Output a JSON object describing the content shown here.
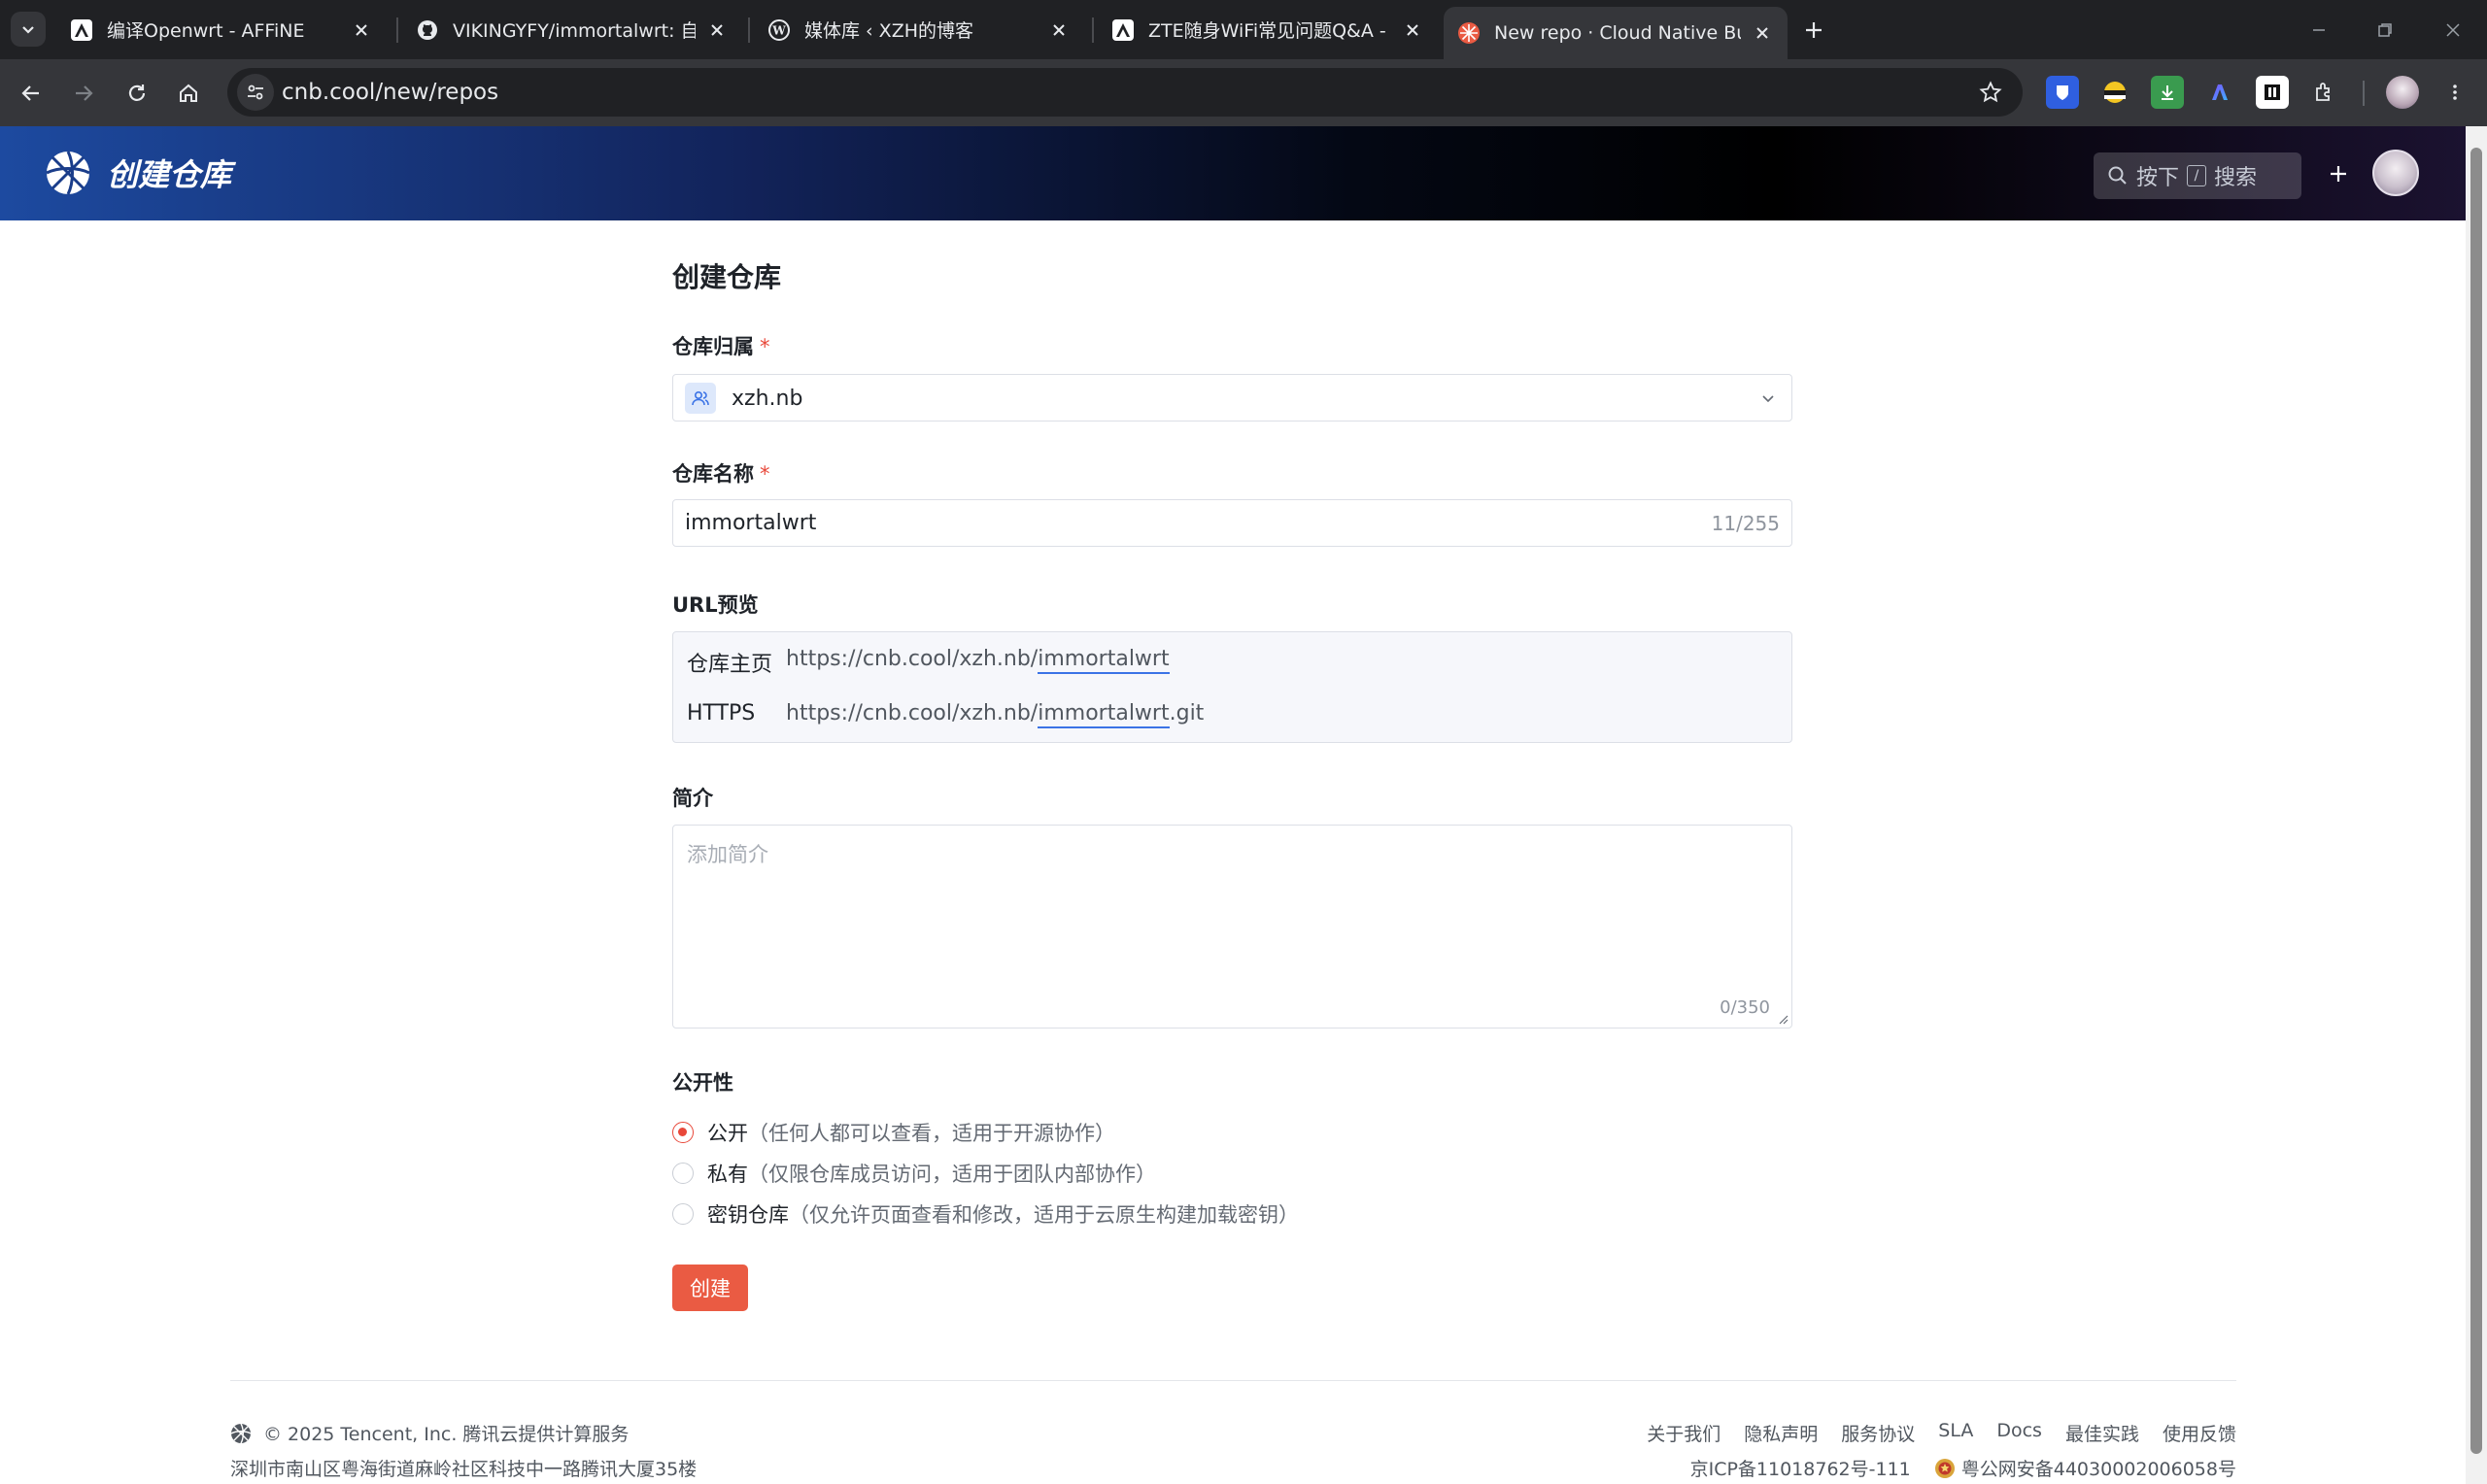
{
  "browser": {
    "tabs": [
      {
        "title": "编译Openwrt - AFFiNE",
        "active": false
      },
      {
        "title": "VIKINGYFY/immortalwrt: 自用",
        "active": false
      },
      {
        "title": "媒体库 ‹ XZH的博客",
        "active": false
      },
      {
        "title": "ZTE随身WiFi常见问题Q&A - A",
        "active": false
      },
      {
        "title": "New repo · Cloud Native Buil",
        "active": true
      }
    ],
    "url": "cnb.cool/new/repos"
  },
  "header": {
    "brand_title": "创建仓库",
    "search_prefix": "按下",
    "search_key": "/",
    "search_suffix": "搜索"
  },
  "form": {
    "title": "创建仓库",
    "owner_label": "仓库归属",
    "required_mark": "*",
    "owner_value": "xzh.nb",
    "name_label": "仓库名称",
    "name_value": "immortalwrt",
    "name_counter": "11/255",
    "url_label": "URL预览",
    "url_home_key": "仓库主页",
    "url_home_prefix": "https://cnb.cool/xzh.nb/",
    "url_home_repo": "immortalwrt",
    "url_https_key": "HTTPS",
    "url_https_prefix": "https://cnb.cool/xzh.nb/",
    "url_https_repo": "immortalwrt",
    "url_https_suffix": ".git",
    "desc_label": "简介",
    "desc_placeholder": "添加简介",
    "desc_counter": "0/350",
    "visibility_label": "公开性",
    "visibility_options": [
      {
        "label": "公开",
        "hint": "（任何人都可以查看，适用于开源协作）",
        "selected": true
      },
      {
        "label": "私有",
        "hint": "（仅限仓库成员访问，适用于团队内部协作）",
        "selected": false
      },
      {
        "label": "密钥仓库",
        "hint": "（仅允许页面查看和修改，适用于云原生构建加载密钥）",
        "selected": false
      }
    ],
    "create_button": "创建"
  },
  "footer": {
    "copyright": "© 2025 Tencent, Inc. 腾讯云提供计算服务",
    "address": "深圳市南山区粤海街道麻岭社区科技中一路腾讯大厦35楼",
    "links": [
      "关于我们",
      "隐私声明",
      "服务协议",
      "SLA",
      "Docs",
      "最佳实践",
      "使用反馈"
    ],
    "icp": "京ICP备11018762号-111",
    "police": "粤公网安备44030002006058号"
  },
  "colors": {
    "accent": "#ea5b43",
    "link_underline": "#3b73e6"
  }
}
